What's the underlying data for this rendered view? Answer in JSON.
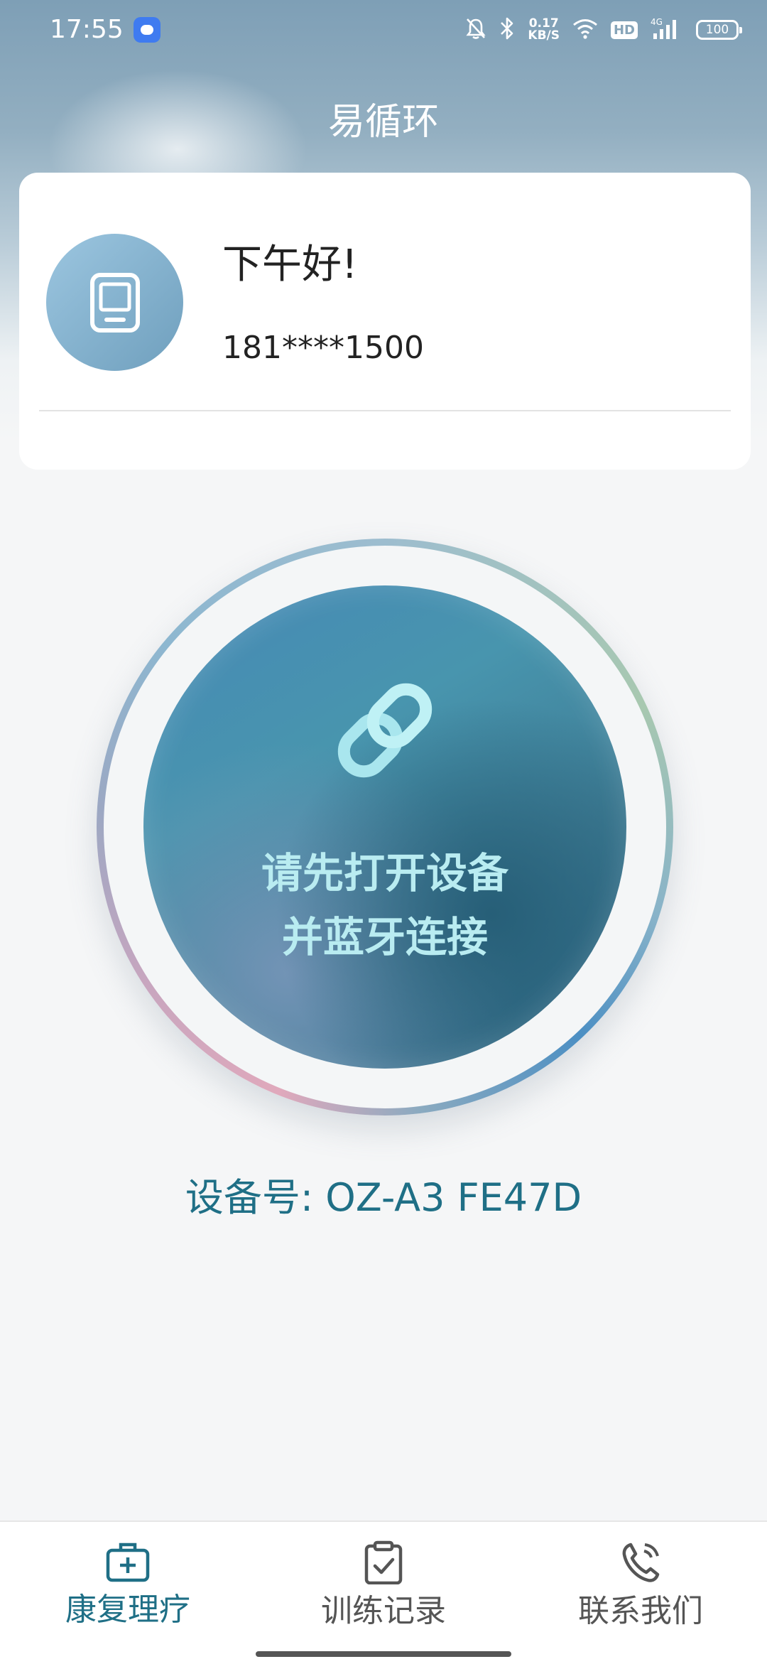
{
  "status_bar": {
    "time": "17:55",
    "net_speed_value": "0.17",
    "net_speed_unit": "KB/S",
    "hd_label": "HD",
    "network_label": "4G",
    "battery": "100"
  },
  "app": {
    "title": "易循环"
  },
  "user_card": {
    "greeting": "下午好!",
    "phone": "181****1500"
  },
  "connect": {
    "line1": "请先打开设备",
    "line2": "并蓝牙连接"
  },
  "device": {
    "label": "设备号:",
    "id": "OZ-A3 FE47D"
  },
  "bottom_nav": {
    "items": [
      {
        "label": "康复理疗",
        "icon": "medical-kit-icon",
        "active": true
      },
      {
        "label": "训练记录",
        "icon": "clipboard-check-icon",
        "active": false
      },
      {
        "label": "联系我们",
        "icon": "phone-icon",
        "active": false
      }
    ]
  },
  "colors": {
    "accent": "#1f6f86",
    "connect_text": "#b9ecf1"
  }
}
